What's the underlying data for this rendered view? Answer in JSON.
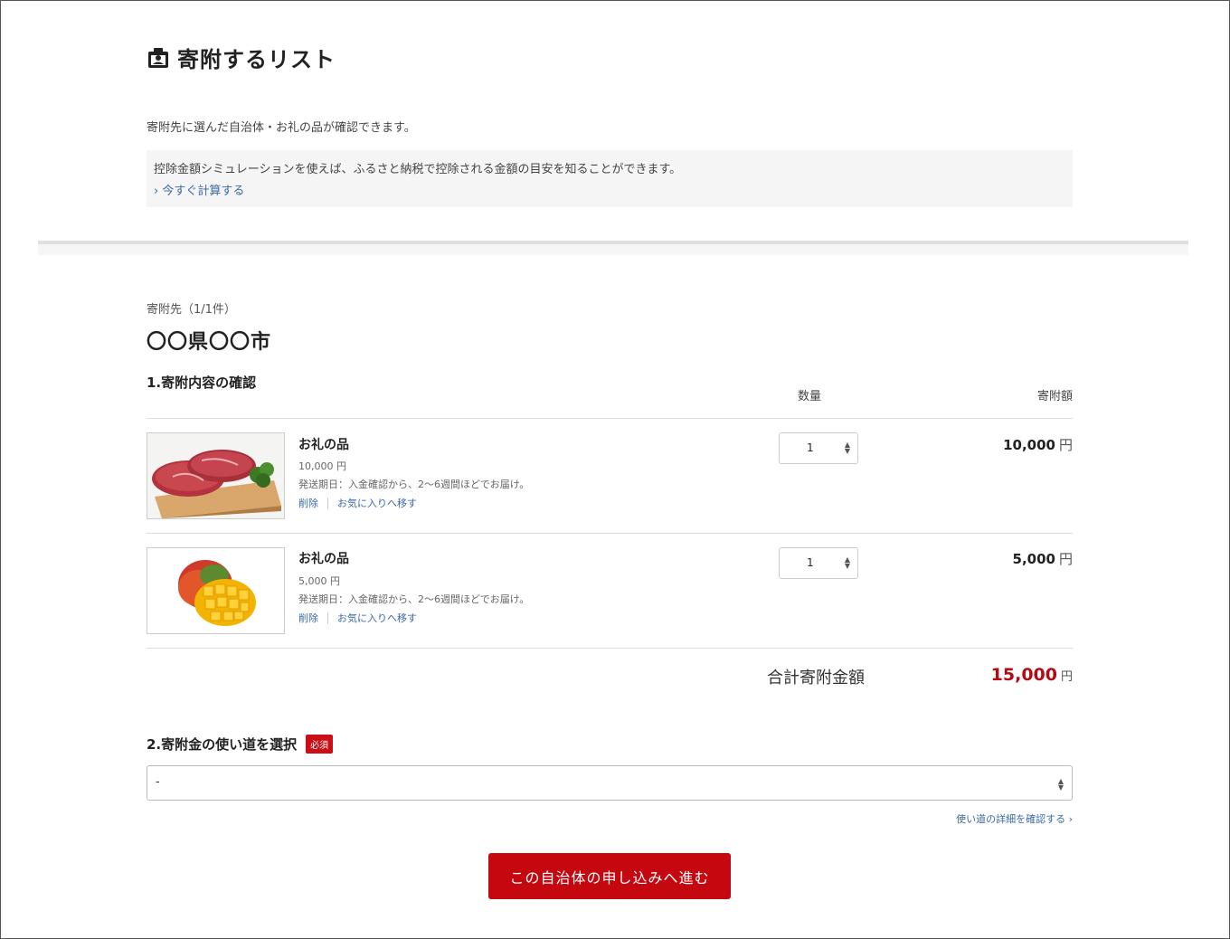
{
  "header": {
    "title": "寄附するリスト",
    "intro": "寄附先に選んだ自治体・お礼の品が確認できます。"
  },
  "simulation": {
    "text": "控除金額シミュレーションを使えば、ふるさと納税で控除される金額の目安を知ることができます。",
    "link": "今すぐ計算する"
  },
  "destination": {
    "label": "寄附先（1/1件）",
    "municipality": "〇〇県〇〇市"
  },
  "section1": {
    "title": "1.寄附内容の確認",
    "col_quantity": "数量",
    "col_amount": "寄附額"
  },
  "items": [
    {
      "name": "お礼の品",
      "price": "10,000 円",
      "shipping": "発送期日：入金確認から、2〜6週間ほどでお届け。",
      "delete": "削除",
      "favorite": "お気に入りへ移す",
      "quantity": "1",
      "amount": "10,000",
      "yen": "円"
    },
    {
      "name": "お礼の品",
      "price": "5,000 円",
      "shipping": "発送期日：入金確認から、2〜6週間ほどでお届け。",
      "delete": "削除",
      "favorite": "お気に入りへ移す",
      "quantity": "1",
      "amount": "5,000",
      "yen": "円"
    }
  ],
  "total": {
    "label": "合計寄附金額",
    "value": "15,000",
    "yen": "円"
  },
  "section2": {
    "title": "2.寄附金の使い道を選択",
    "required_badge": "必須",
    "select_value": "-",
    "usage_link": "使い道の詳細を確認する ›"
  },
  "cta": {
    "label": "この自治体の申し込みへ進む"
  },
  "colors": {
    "accent": "#c5080f",
    "total": "#b40a14",
    "link": "#3b6aa6"
  }
}
